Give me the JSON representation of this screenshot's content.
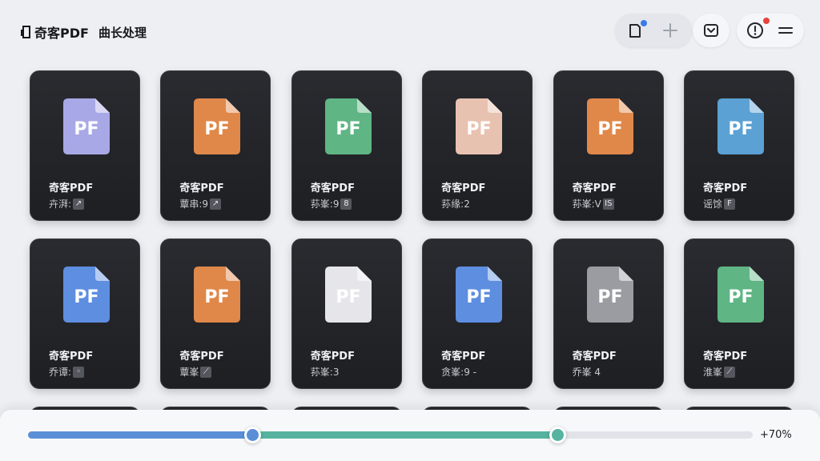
{
  "header": {
    "app_title": "奇客PDF",
    "subtitle": "曲长处理",
    "toolbar": [
      {
        "name": "document-icon",
        "badge": true
      },
      {
        "name": "plus-icon"
      },
      {
        "name": "inbox-icon"
      },
      {
        "name": "alert-icon",
        "badge": true
      },
      {
        "name": "menu-icon"
      }
    ]
  },
  "colors": {
    "accent_blue": "#5a8fd8",
    "accent_teal": "#55b3a0",
    "badge_blue": "#3b7be8",
    "badge_red": "#e8423b",
    "card_bg": "#23242a",
    "page_bg": "#eeeff3"
  },
  "files": [
    {
      "icon_label": "PF",
      "name": "奇客PDF",
      "meta": "卉湃:",
      "tag": "↗",
      "color": "#a9a8e6"
    },
    {
      "icon_label": "PF",
      "name": "奇客PDF",
      "meta": "蕈串:9",
      "tag": "↗",
      "color": "#e0884a"
    },
    {
      "icon_label": "PF",
      "name": "奇客PDF",
      "meta": "荪峯:9",
      "tag": "8",
      "color": "#5fb584"
    },
    {
      "icon_label": "PF",
      "name": "奇客PDF",
      "meta": "荪缘:2",
      "tag": "",
      "color": "#e8c2b0"
    },
    {
      "icon_label": "PF",
      "name": "奇客PDF",
      "meta": "荪峯:V",
      "tag": "IS",
      "color": "#e0884a"
    },
    {
      "icon_label": "PF",
      "name": "奇客PDF",
      "meta": "谣馀",
      "tag": "F",
      "color": "#5ba1d4"
    },
    {
      "icon_label": "PF",
      "name": "奇客PDF",
      "meta": "乔谭:",
      "tag": "◦",
      "color": "#5e8ee0"
    },
    {
      "icon_label": "PF",
      "name": "奇客PDF",
      "meta": "蕈峯",
      "tag": "⟋",
      "color": "#e0884a"
    },
    {
      "icon_label": "PF",
      "name": "奇客PDF",
      "meta": "荪峯:3",
      "tag": "",
      "color": "#e6e6ea"
    },
    {
      "icon_label": "PF",
      "name": "奇客PDF",
      "meta": "贪峯:9 -",
      "tag": "",
      "color": "#5e8ee0"
    },
    {
      "icon_label": "PF",
      "name": "奇客PDF",
      "meta": "乔峯 4",
      "tag": "",
      "color": "#9a9ca2"
    },
    {
      "icon_label": "PF",
      "name": "奇客PDF",
      "meta": "淮峯",
      "tag": "⟋",
      "color": "#5fb584"
    }
  ],
  "slider": {
    "start_fraction": 0.31,
    "end_fraction": 0.731,
    "label": "+70%"
  }
}
